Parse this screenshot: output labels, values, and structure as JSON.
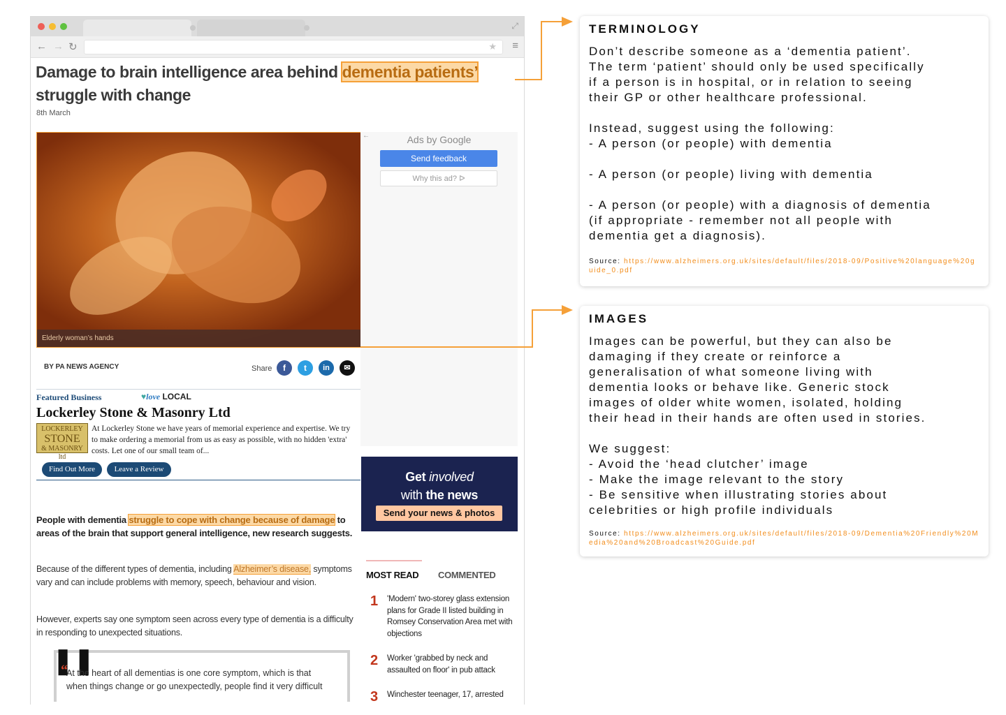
{
  "article": {
    "headline_part1": "Damage to brain intelligence area behind ",
    "headline_highlight": "dementia patients’",
    "headline_part2": " struggle with change",
    "date": "8th March",
    "image_caption": "Elderly woman’s hands",
    "byline": "BY PA NEWS AGENCY",
    "share_label": "Share",
    "share_icons": [
      "facebook-icon",
      "twitter-icon",
      "linkedin-icon",
      "email-icon"
    ],
    "lead_part1": "People with dementia ",
    "lead_highlight": "struggle to cope with change because of damage",
    "lead_part2": " to areas of the brain that support general intelligence, new research suggests.",
    "p1_part1": "Because of the different types of dementia, including ",
    "p1_highlight": "Alzheimer’s disease,",
    "p1_part2": " symptoms vary and can include problems with memory, speech, behaviour and vision.",
    "p2": "However, experts say one symptom seen across every type of dementia is a difficulty in responding to unexpected situations.",
    "quote": "At the heart of all dementias is one core symptom, which is that when things change or go unexpectedly, people find it very difficult"
  },
  "ad": {
    "ads_by": "Ads by Google",
    "send_feedback": "Send feedback",
    "why_this_ad": "Why this ad? ᐅ"
  },
  "featured": {
    "label": "Featured Business",
    "love": "love",
    "local": "LOCAL",
    "business_name": "Lockerley Stone & Masonry Ltd",
    "logo_line1": "LOCKERLEY",
    "logo_line2": "STONE",
    "logo_line3": "& MASONRY ltd",
    "description": "At Lockerley Stone we have years of memorial experience and expertise. We try to make ordering a memorial from us as easy as possible, with no hidden 'extra' costs. Let one of our small team of...",
    "find_out_more": "Find Out More",
    "leave_review": "Leave a Review"
  },
  "get_involved": {
    "get": "Get",
    "involved": "involved",
    "with": "with",
    "the_news": "the news",
    "button": "Send your news & photos"
  },
  "most_read": {
    "tab_most_read": "MOST READ",
    "tab_commented": "COMMENTED",
    "items": [
      {
        "num": "1",
        "text": "'Modern' two-storey glass extension plans for Grade II listed building in Romsey Conservation Area met with objections"
      },
      {
        "num": "2",
        "text": "Worker 'grabbed by neck and assaulted on floor' in pub attack"
      },
      {
        "num": "3",
        "text": "Winchester teenager, 17, arrested"
      }
    ]
  },
  "terminology": {
    "title": "TERMINOLOGY",
    "body": "Don’t describe someone as a ‘dementia patient’.\nThe term ‘patient’ should only be used specifically\nif a person is in hospital, or in relation to seeing\ntheir GP or other healthcare professional.\n\nInstead, suggest using the following:\n- A person (or people) with dementia\n\n- A person (or people) living with dementia\n\n- A person (or people) with a diagnosis of dementia\n(if appropriate - remember not all people with\ndementia get a diagnosis).",
    "source_label": "Source: ",
    "source_url": "https://www.alzheimers.org.uk/sites/default/files/2018-09/Positive%20language%20guide_0.pdf"
  },
  "images_note": {
    "title": "IMAGES",
    "body": "Images can be powerful, but they can also be\ndamaging if they create or reinforce a\ngeneralisation of what someone living with\ndementia looks or behave like. Generic stock\nimages of older white women, isolated, holding\ntheir head in their hands are often used in stories.\n\nWe suggest:\n- Avoid the ‘head clutcher’ image\n- Make the image relevant to the story\n- Be sensitive when illustrating stories about\ncelebrities or high profile individuals",
    "source_label": "Source: ",
    "source_url": "https://www.alzheimers.org.uk/sites/default/files/2018-09/Dementia%20Friendly%20Media%20and%20Broadcast%20Guide.pdf"
  },
  "colors": {
    "accent_orange": "#f5a038",
    "highlight_bg": "#fcd9a6",
    "navy": "#1b2350",
    "link_orange": "#f28c1a"
  }
}
